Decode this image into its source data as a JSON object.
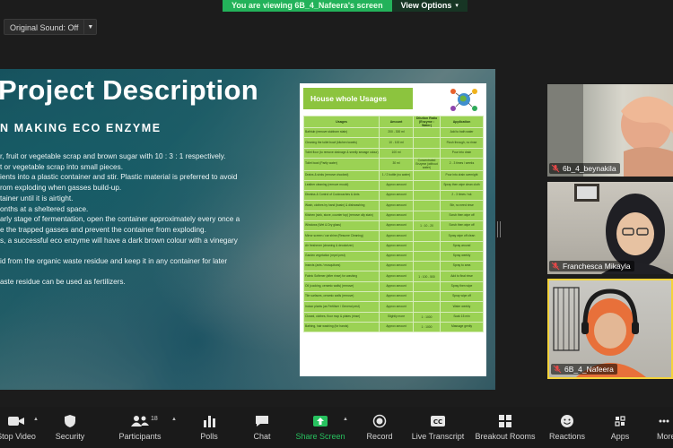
{
  "banner": {
    "viewing_text": "You are viewing 6B_4_Nafeera's screen",
    "options_label": "View Options"
  },
  "sound": {
    "label": "Original Sound: Off"
  },
  "slide": {
    "title": "Project Description",
    "subtitle": "N MAKING ECO ENZYME",
    "lines": [
      "r, fruit or vegetable scrap and brown sugar with 10 : 3 : 1 respectively.",
      "t or vegetable scrap into small pieces.",
      "ients into a plastic container and stir. Plastic material is preferred to avoid",
      "rom exploding when gasses build-up.",
      "tainer until it is airtight.",
      "onths at a sheltered space.",
      "arly stage of fermentation, open the container approximately every once a",
      "e the trapped gasses and prevent the container from exploding.",
      "s, a successful eco enzyme will have a dark brown colour with a vinegary",
      "",
      "id from the organic waste residue and keep it in any container for later",
      "",
      "aste residue can be used as fertilizers."
    ]
  },
  "usage": {
    "title": "House whole Usages",
    "headers": [
      "Usages",
      "Amount",
      "Dilution Ratio (Enzyme : Water)",
      "Application"
    ],
    "rows": [
      [
        "Bathtub (remove stubborn stain)",
        "200 - 300 ml",
        "",
        "Add to bath water"
      ],
      [
        "Cleaning the toilet bowl (kitchen towels)",
        "10 - 100 ml",
        "",
        "Flush through, no rinse"
      ],
      [
        "Toilet floor (to remove drainage & smelly sewage odour)",
        "100 ml",
        "",
        "Pour into drain"
      ],
      [
        "Toilet bowl (Partly water)",
        "30 ml",
        "Concentrated Enzyme (without water)",
        "2 - 3 times / weeks"
      ],
      [
        "Drains & sinks (remove chocked)",
        "1 / 2 bottle (no water)",
        "",
        "Pour into drain overnight"
      ],
      [
        "Leather cleaning (remove mould)",
        "Approx amount",
        "",
        "Spray then wipe clean cloth"
      ],
      [
        "Dismiss & Control of Cockroaches & Ants",
        "Approx amount",
        "",
        "2 - 3 times / wk"
      ],
      [
        "Wash, clothes by hand (basin) & dishwashing",
        "Approx amount",
        "",
        "Stir, no need rinse"
      ],
      [
        "Kitchen (sink, stove, counter top) (remove oily stain)",
        "Approx amount",
        "",
        "Scrub then wipe off"
      ],
      [
        "Windows (Wet & Dry glass)",
        "Approx amount",
        "1 : 10 - 20",
        "Scrub then wipe off"
      ],
      [
        "Mirror screen / car shine (Resume Cleaning)",
        "Approx amount",
        "",
        "Spray wipe off clean"
      ],
      [
        "Air freshener (cleaning & deodorizer)",
        "Approx amount",
        "",
        "Spray around"
      ],
      [
        "Garden vegetation (repel pest)",
        "Approx amount",
        "",
        "Spray weekly"
      ],
      [
        "Insects (ants / mosquitoes)",
        "Approx amount",
        "",
        "Spray to area"
      ],
      [
        "Fabric Softener (after rinse) for washing",
        "Approx amount",
        "1 : 100 - 500",
        "Add to final rinse"
      ],
      [
        "Oil (cooking, ceramic walls) (remove)",
        "Approx amount",
        "",
        "Spray then wipe"
      ],
      [
        "Tile surfaces, ceramic walls (remove)",
        "Approx amount",
        "",
        "Spray wipe off"
      ],
      [
        "Indoor plants (as Fertiliser / General pest)",
        "Approx amount",
        "",
        "Water weekly"
      ],
      [
        "Closed, clothes, floor mop & plates (rinse)",
        "Slightly more",
        "1 : 1000",
        "Soak 15 min"
      ],
      [
        "Bathing, hair washing (for hands)",
        "Approx amount",
        "1 : 1000",
        "Massage gently"
      ]
    ]
  },
  "participants": [
    {
      "name": "6b_4_beynakila"
    },
    {
      "name": "Franchesca Mikayla"
    },
    {
      "name": "6B_4_Nafeera"
    }
  ],
  "toolbar": {
    "stop_video": "Stop Video",
    "security": "Security",
    "participants": "Participants",
    "participants_count": "18",
    "polls": "Polls",
    "chat": "Chat",
    "share_screen": "Share Screen",
    "record": "Record",
    "live_transcript": "Live Transcript",
    "breakout_rooms": "Breakout Rooms",
    "reactions": "Reactions",
    "apps": "Apps",
    "more": "More"
  },
  "colors": {
    "share_green": "#27c25f",
    "banner_green": "#23b25a",
    "active_speaker": "#f3d33b",
    "table_green": "#9bd254"
  }
}
